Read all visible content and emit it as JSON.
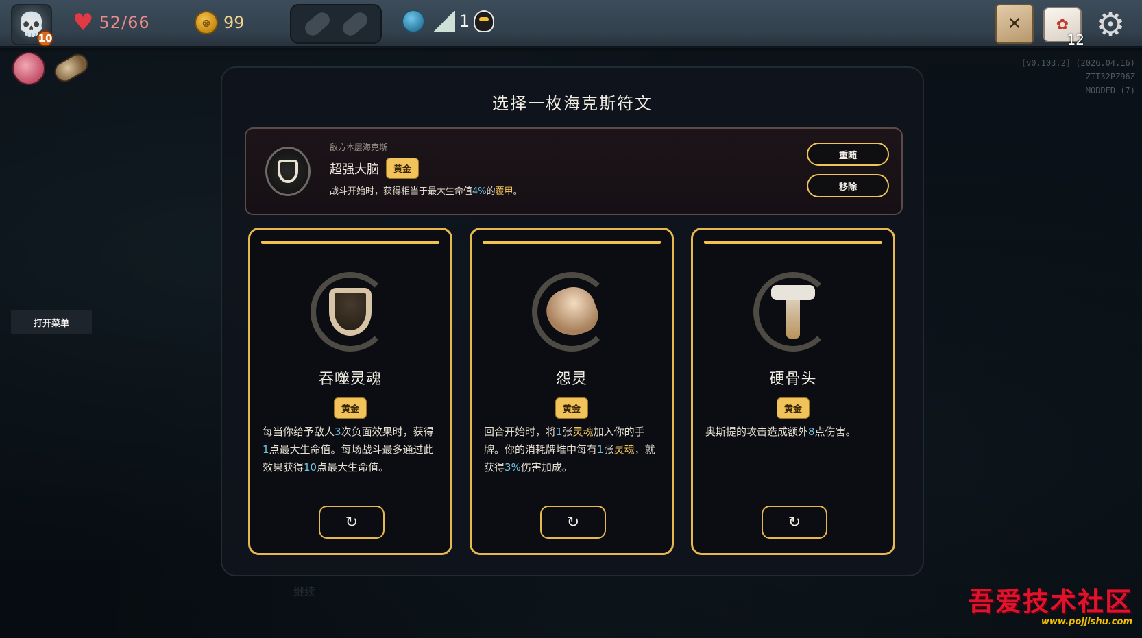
{
  "hud": {
    "portrait_icon": "skull-portrait-icon",
    "level": "10",
    "hp": "52/66",
    "gold": "99",
    "floor": "1",
    "deck_count": "12",
    "map_glyph": "✕"
  },
  "version": {
    "line1": "[v0.103.2] (2026.04.16)",
    "line2": "ZTT32PZ96Z",
    "line3": "MODDED (7)"
  },
  "side": {
    "open_menu": "打开菜单"
  },
  "modal": {
    "title": "选择一枚海克斯符文",
    "enemy": {
      "subtitle": "敌方本层海克斯",
      "name": "超强大脑",
      "rarity": "黄金",
      "desc_pre": "战斗开始时，获得相当于最大生命值",
      "desc_pct": "4%",
      "desc_mid": "的",
      "desc_kw": "覆甲",
      "desc_post": "。",
      "reroll_label": "重随",
      "remove_label": "移除"
    },
    "cards": [
      {
        "name": "吞噬灵魂",
        "rarity": "黄金",
        "desc": [
          {
            "t": "每当你给予敌人",
            "c": ""
          },
          {
            "t": "3",
            "c": "hl-blue"
          },
          {
            "t": "次负面效果时，获得",
            "c": ""
          },
          {
            "t": "1",
            "c": "hl-blue"
          },
          {
            "t": "点最大生命值。每场战斗最多通过此效果获得",
            "c": ""
          },
          {
            "t": "10",
            "c": "hl-blue"
          },
          {
            "t": "点最大生命值。",
            "c": ""
          }
        ],
        "reroll_icon": "↻"
      },
      {
        "name": "怨灵",
        "rarity": "黄金",
        "desc": [
          {
            "t": "回合开始时，将",
            "c": ""
          },
          {
            "t": "1",
            "c": "hl-blue"
          },
          {
            "t": "张",
            "c": ""
          },
          {
            "t": "灵魂",
            "c": "hl-gold"
          },
          {
            "t": "加入你的手牌。你的消耗牌堆中每有",
            "c": ""
          },
          {
            "t": "1",
            "c": "hl-blue"
          },
          {
            "t": "张",
            "c": ""
          },
          {
            "t": "灵魂",
            "c": "hl-gold"
          },
          {
            "t": "，就获得",
            "c": ""
          },
          {
            "t": "3%",
            "c": "hl-blue"
          },
          {
            "t": "伤害加成。",
            "c": ""
          }
        ],
        "reroll_icon": "↻"
      },
      {
        "name": "硬骨头",
        "rarity": "黄金",
        "desc": [
          {
            "t": "奥斯提的攻击造成额外",
            "c": ""
          },
          {
            "t": "8",
            "c": "hl-blue"
          },
          {
            "t": "点伤害。",
            "c": ""
          }
        ],
        "reroll_icon": "↻"
      }
    ]
  },
  "continue_label": "继续",
  "watermark": {
    "main": "吾爱技术社区",
    "sub": "www.pojjishu.com"
  },
  "colors": {
    "accent_gold": "#f1c35a",
    "highlight_blue": "#6fc3e0",
    "hp_red": "#e23a45"
  }
}
